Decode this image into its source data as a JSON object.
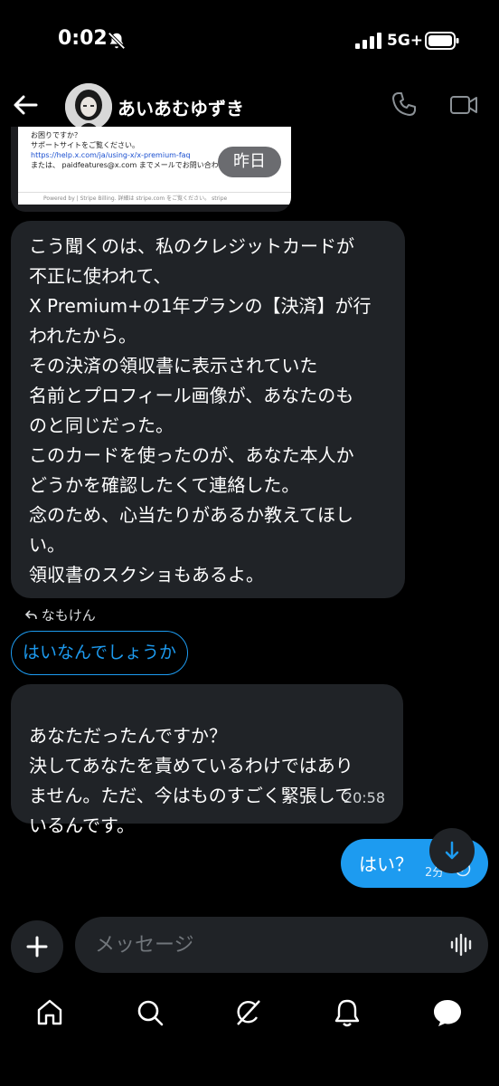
{
  "status_bar": {
    "time": "0:02",
    "network": "5G+",
    "icons": [
      "bell-slash-icon",
      "signal-icon",
      "battery-icon"
    ]
  },
  "header": {
    "contact_name": "あいあむゆずき",
    "icons": [
      "back-arrow-icon",
      "phone-icon",
      "video-camera-icon"
    ]
  },
  "receipt_image": {
    "lines": [
      "お困りですか？",
      "サポートサイトをご覧ください。",
      "https://help.x.com/ja/using-x/x-premium-faq",
      "または、 paidfeatures@x.com までメールでお問い合わせください。"
    ],
    "footer": "Powered by  |  Stripe Billing. 詳細は stripe.com をご覧ください。   stripe",
    "date_chip": "昨日"
  },
  "messages": [
    {
      "direction": "incoming",
      "text": "こう聞くのは、私のクレジットカードが\n不正に使われて、\nX Premium+の1年プランの【決済】が行\nわれたから。\nその決済の領収書に表示されていた\n名前とプロフィール画像が、あなたのも\nのと同じだった。\nこのカードを使ったのが、あなた本人か\nどうかを確認したくて連絡した。\n念のため、心当たりがあるか教えてほし\nい。\n領収書のスクショもあるよ。"
    },
    {
      "direction": "incoming",
      "text": "あなただったんですか？\n決してあなたを責めているわけではあり\nません。ただ、今はものすごく緊張して\nいるんです。",
      "time": "20:58"
    },
    {
      "direction": "outgoing",
      "text": "はい？",
      "time": "2分"
    }
  ],
  "reply_context": {
    "label": "なもけん",
    "quick_reply": "はいなんでしょうか"
  },
  "composer": {
    "placeholder": "メッセージ",
    "value": ""
  },
  "bottom_nav": [
    "home-icon",
    "search-icon",
    "grok-icon",
    "notifications-icon",
    "messages-icon"
  ],
  "colors": {
    "background": "#000000",
    "incoming_bubble": "#202327",
    "accent": "#1d9bf0",
    "text": "#ffffff"
  }
}
